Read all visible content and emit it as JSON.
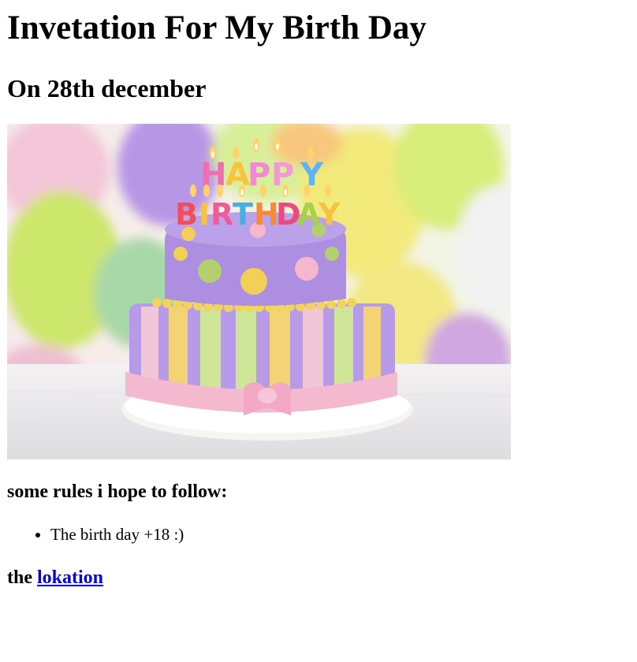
{
  "page": {
    "title": "Invetation For My Birth Day",
    "subtitle": "On 28th december"
  },
  "image": {
    "candle_letters_top": [
      "H",
      "A",
      "P",
      "P",
      "Y"
    ],
    "candle_letters_bottom": [
      "B",
      "I",
      "R",
      "T",
      "H",
      "D",
      "A",
      "Y"
    ]
  },
  "rules": {
    "heading": "some rules i hope to follow:",
    "items": [
      "The birth day +18 :)"
    ]
  },
  "location": {
    "prefix": "the ",
    "link_text": "lokation"
  }
}
